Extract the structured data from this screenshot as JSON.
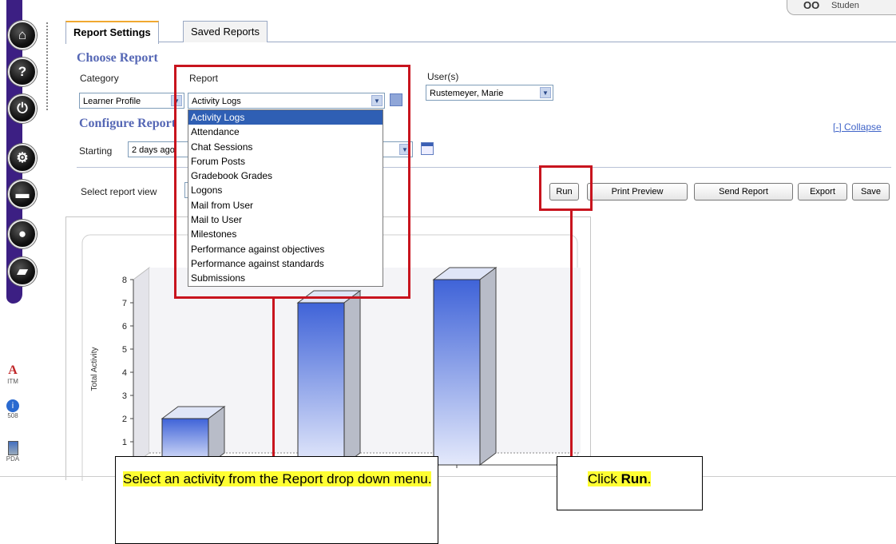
{
  "header": {
    "user_label": "Studen"
  },
  "tabs": [
    {
      "label": "Report Settings"
    },
    {
      "label": "Saved Reports"
    }
  ],
  "choose_report": {
    "title": "Choose Report",
    "category_label": "Category",
    "category_value": "Learner Profile",
    "report_label": "Report",
    "report_value": "Activity Logs",
    "users_label": "User(s)",
    "users_value": "Rustemeyer, Marie"
  },
  "configure_report": {
    "title": "Configure Report",
    "collapse_link": "[-] Collapse",
    "starting_label": "Starting",
    "starting_value": "2 days ago"
  },
  "report_view": {
    "label": "Select report view"
  },
  "buttons": {
    "run": "Run",
    "print_preview": "Print Preview",
    "send_report": "Send Report",
    "export": "Export",
    "save": "Save"
  },
  "dropdown": {
    "options": [
      "Activity Logs",
      "Attendance",
      "Chat Sessions",
      "Forum Posts",
      "Gradebook Grades",
      "Logons",
      "Mail from User",
      "Mail to User",
      "Milestones",
      "Performance against objectives",
      "Performance against standards",
      "Submissions"
    ],
    "selected": "Activity Logs"
  },
  "left_tools": [
    {
      "label": "ITM"
    },
    {
      "label": "508"
    },
    {
      "label": "PDA"
    }
  ],
  "chart_data": {
    "type": "bar",
    "ylabel": "Total Activity",
    "ylim": [
      0,
      8
    ],
    "yticks": [
      "0",
      "1",
      "2",
      "3",
      "4",
      "5",
      "6",
      "7",
      "8"
    ],
    "values": [
      2,
      7,
      8
    ],
    "bar_color": "#3a5fd6"
  },
  "callouts": {
    "select_activity": "Select an activity from the Report drop down menu.",
    "click_prefix": "Click ",
    "click_run": "Run",
    "click_suffix": "."
  }
}
